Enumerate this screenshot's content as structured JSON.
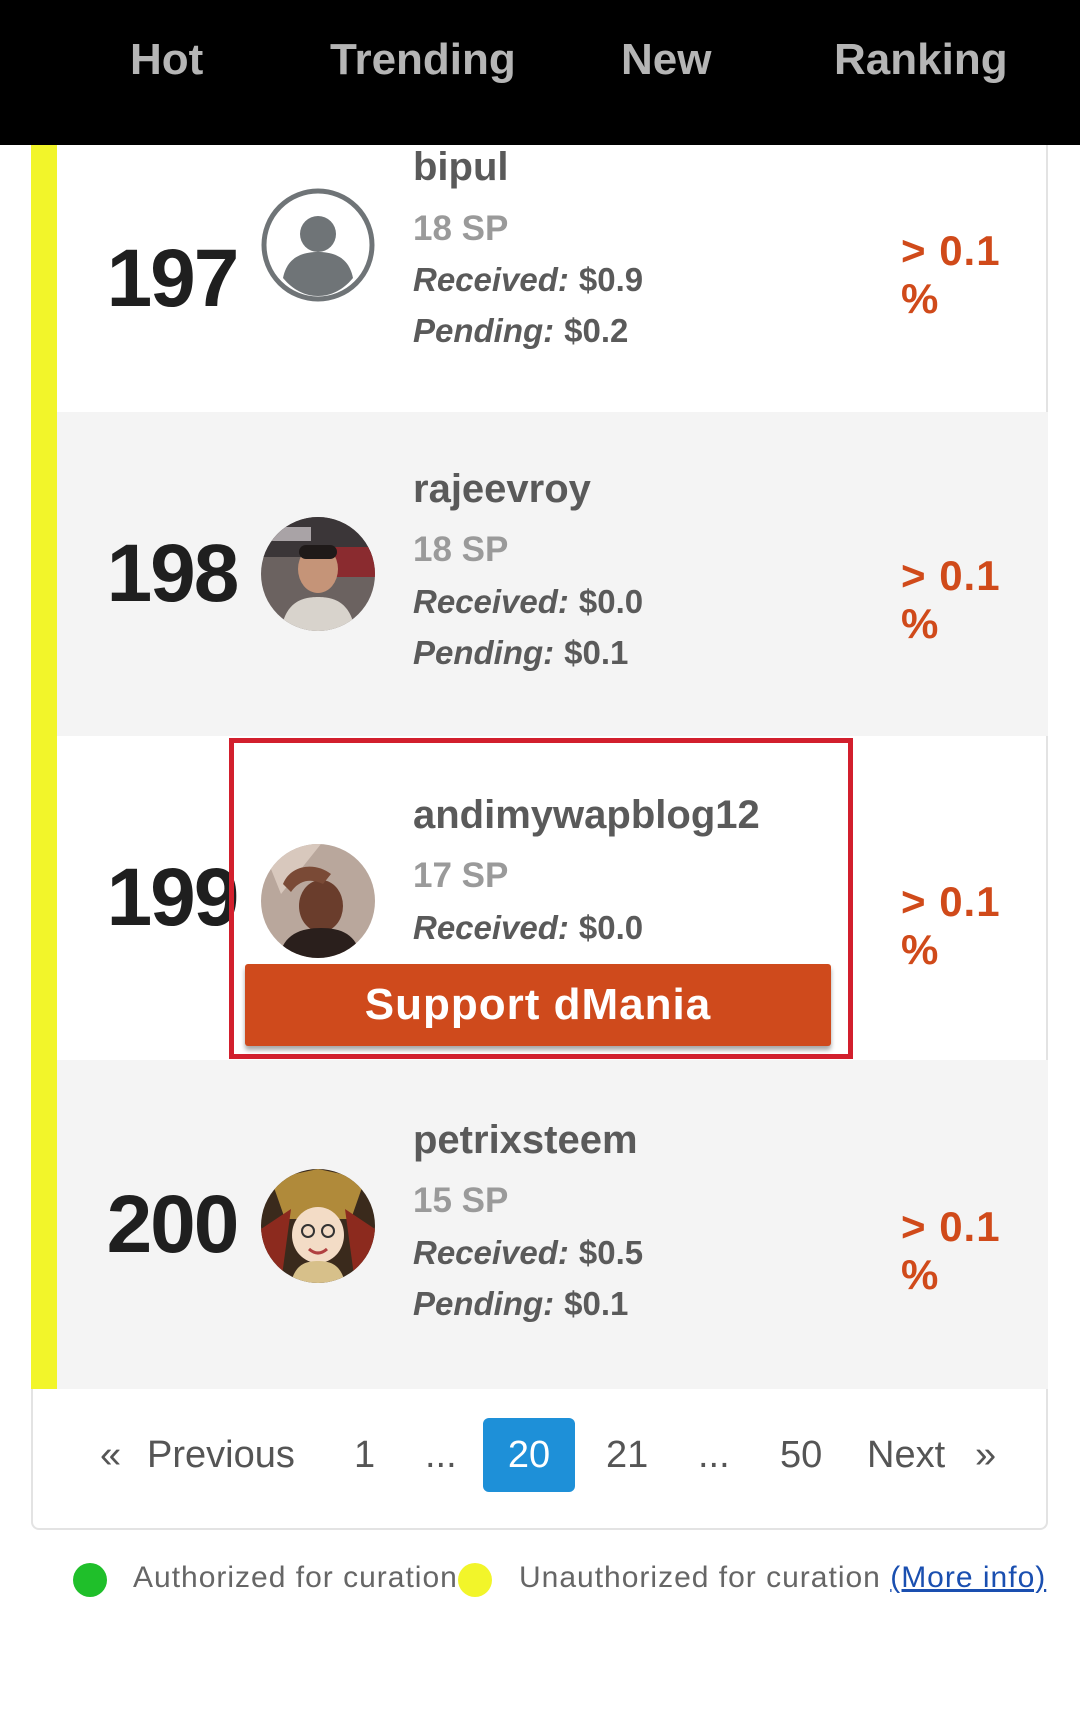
{
  "nav": {
    "tabs": [
      "Hot",
      "Trending",
      "New",
      "Ranking"
    ]
  },
  "colors": {
    "unauthorized_bar": "#f2f52a",
    "authorized_dot": "#1fbf2a",
    "unauthorized_dot": "#f2f52a",
    "percent": "#d04a1a",
    "support_button": "#cf4a1c",
    "active_page": "#1e90d8",
    "highlight_border": "#d21f2d"
  },
  "rows": [
    {
      "rank": "197",
      "username": "bipul",
      "sp": "18 SP",
      "received_label": "Received:",
      "received_value": "$0.9",
      "pending_label": "Pending:",
      "pending_value": "$0.2",
      "percent": "> 0.1 %",
      "avatar": "default-user-icon"
    },
    {
      "rank": "198",
      "username": "rajeevroy",
      "sp": "18 SP",
      "received_label": "Received:",
      "received_value": "$0.0",
      "pending_label": "Pending:",
      "pending_value": "$0.1",
      "percent": "> 0.1 %",
      "avatar": "user-photo"
    },
    {
      "rank": "199",
      "username": "andimywapblog12",
      "sp": "17 SP",
      "received_label": "Received:",
      "received_value": "$0.0",
      "percent": "> 0.1 %",
      "avatar": "user-photo",
      "support_button": "Support dMania"
    },
    {
      "rank": "200",
      "username": "petrixsteem",
      "sp": "15 SP",
      "received_label": "Received:",
      "received_value": "$0.5",
      "pending_label": "Pending:",
      "pending_value": "$0.1",
      "percent": "> 0.1 %",
      "avatar": "user-illustration"
    }
  ],
  "pagination": {
    "prev_arrow": "«",
    "previous": "Previous",
    "pages": [
      "1",
      "...",
      "20",
      "21",
      "...",
      "50"
    ],
    "active_page": "20",
    "next": "Next",
    "next_arrow": "»"
  },
  "legend": {
    "authorized": "Authorized for curation",
    "unauthorized": "Unauthorized for curation",
    "more_info": "(More info)"
  }
}
